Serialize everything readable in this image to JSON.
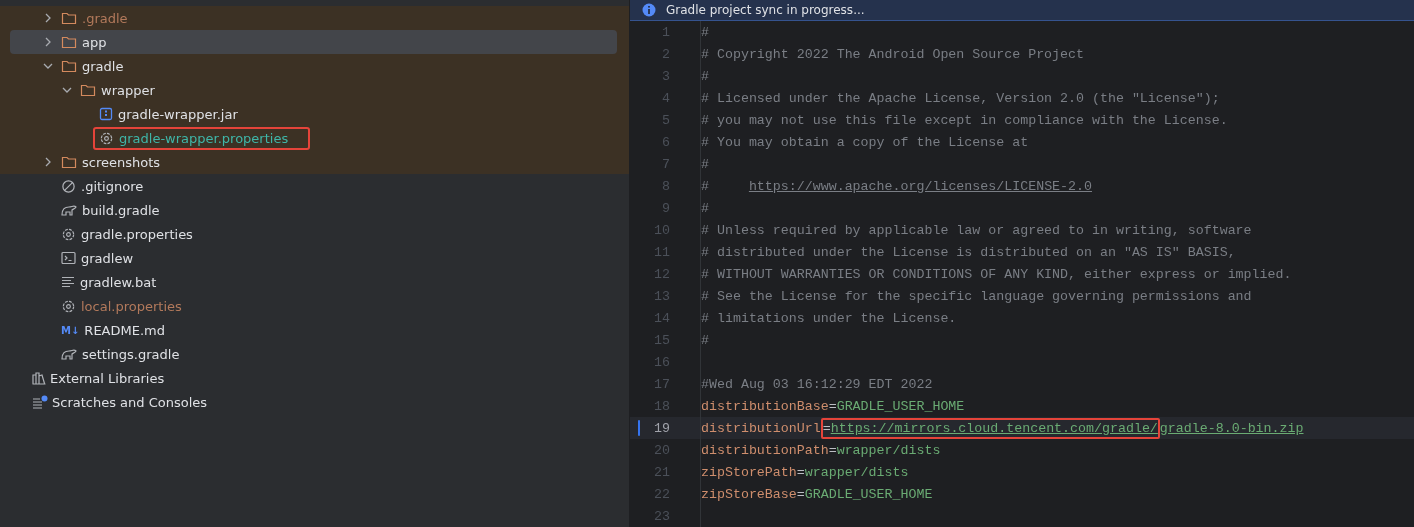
{
  "project_tree": {
    "items": [
      {
        "label": ".gradle",
        "kind": "folder",
        "expanded": false,
        "selected": false,
        "highlighted": true,
        "ignored": true,
        "modified": false,
        "outlined": false
      },
      {
        "label": "app",
        "kind": "folder",
        "expanded": false,
        "selected": true,
        "highlighted": true,
        "ignored": false,
        "modified": false,
        "outlined": false
      },
      {
        "label": "gradle",
        "kind": "folder",
        "expanded": true,
        "selected": false,
        "highlighted": true,
        "ignored": false,
        "modified": false,
        "outlined": false,
        "children": [
          {
            "label": "wrapper",
            "kind": "folder",
            "expanded": true,
            "selected": false,
            "highlighted": true,
            "ignored": false,
            "modified": false,
            "outlined": false,
            "children": [
              {
                "label": "gradle-wrapper.jar",
                "kind": "jar",
                "selected": false,
                "highlighted": true,
                "ignored": false,
                "modified": false,
                "outlined": false
              },
              {
                "label": "gradle-wrapper.properties",
                "kind": "properties",
                "selected": false,
                "highlighted": true,
                "ignored": false,
                "modified": true,
                "outlined": true
              }
            ]
          }
        ]
      },
      {
        "label": "screenshots",
        "kind": "folder",
        "expanded": false,
        "selected": false,
        "highlighted": true,
        "ignored": false,
        "modified": false,
        "outlined": false
      },
      {
        "label": ".gitignore",
        "kind": "ignore",
        "selected": false,
        "highlighted": false,
        "ignored": false,
        "modified": false,
        "outlined": false
      },
      {
        "label": "build.gradle",
        "kind": "gradle",
        "selected": false,
        "highlighted": false,
        "ignored": false,
        "modified": false,
        "outlined": false
      },
      {
        "label": "gradle.properties",
        "kind": "properties",
        "selected": false,
        "highlighted": false,
        "ignored": false,
        "modified": false,
        "outlined": false
      },
      {
        "label": "gradlew",
        "kind": "script",
        "selected": false,
        "highlighted": false,
        "ignored": false,
        "modified": false,
        "outlined": false
      },
      {
        "label": "gradlew.bat",
        "kind": "text",
        "selected": false,
        "highlighted": false,
        "ignored": false,
        "modified": false,
        "outlined": false
      },
      {
        "label": "local.properties",
        "kind": "properties",
        "selected": false,
        "highlighted": false,
        "ignored": true,
        "modified": false,
        "outlined": false
      },
      {
        "label": "README.md",
        "kind": "markdown",
        "icon_label": "M↓",
        "selected": false,
        "highlighted": false,
        "ignored": false,
        "modified": false,
        "outlined": false
      },
      {
        "label": "settings.gradle",
        "kind": "gradle",
        "selected": false,
        "highlighted": false,
        "ignored": false,
        "modified": false,
        "outlined": false
      }
    ],
    "root_items": [
      {
        "label": "External Libraries",
        "kind": "libraries",
        "selected": false
      },
      {
        "label": "Scratches and Consoles",
        "kind": "scratches",
        "selected": false
      }
    ]
  },
  "editor": {
    "banner": "Gradle project sync in progress...",
    "lines": [
      {
        "number": "1",
        "current": false,
        "tokens": [
          {
            "kind": "comment",
            "text": "#"
          }
        ]
      },
      {
        "number": "2",
        "current": false,
        "tokens": [
          {
            "kind": "comment",
            "text": "# Copyright 2022 The Android Open Source Project"
          }
        ]
      },
      {
        "number": "3",
        "current": false,
        "tokens": [
          {
            "kind": "comment",
            "text": "#"
          }
        ]
      },
      {
        "number": "4",
        "current": false,
        "tokens": [
          {
            "kind": "comment",
            "text": "# Licensed under the Apache License, Version 2.0 (the \"License\");"
          }
        ]
      },
      {
        "number": "5",
        "current": false,
        "tokens": [
          {
            "kind": "comment",
            "text": "# you may not use this file except in compliance with the License."
          }
        ]
      },
      {
        "number": "6",
        "current": false,
        "tokens": [
          {
            "kind": "comment",
            "text": "# You may obtain a copy of the License at"
          }
        ]
      },
      {
        "number": "7",
        "current": false,
        "tokens": [
          {
            "kind": "comment",
            "text": "#"
          }
        ]
      },
      {
        "number": "8",
        "current": false,
        "tokens": [
          {
            "kind": "comment",
            "text": "#     "
          },
          {
            "kind": "comment_link",
            "text": "https://www.apache.org/licenses/LICENSE-2.0"
          }
        ]
      },
      {
        "number": "9",
        "current": false,
        "tokens": [
          {
            "kind": "comment",
            "text": "#"
          }
        ]
      },
      {
        "number": "10",
        "current": false,
        "tokens": [
          {
            "kind": "comment",
            "text": "# Unless required by applicable law or agreed to in writing, software"
          }
        ]
      },
      {
        "number": "11",
        "current": false,
        "tokens": [
          {
            "kind": "comment",
            "text": "# distributed under the License is distributed on an \"AS IS\" BASIS,"
          }
        ]
      },
      {
        "number": "12",
        "current": false,
        "tokens": [
          {
            "kind": "comment",
            "text": "# WITHOUT WARRANTIES OR CONDITIONS OF ANY KIND, either express or implied."
          }
        ]
      },
      {
        "number": "13",
        "current": false,
        "tokens": [
          {
            "kind": "comment",
            "text": "# See the License for the specific language governing permissions and"
          }
        ]
      },
      {
        "number": "14",
        "current": false,
        "tokens": [
          {
            "kind": "comment",
            "text": "# limitations under the License."
          }
        ]
      },
      {
        "number": "15",
        "current": false,
        "tokens": [
          {
            "kind": "comment",
            "text": "#"
          }
        ]
      },
      {
        "number": "16",
        "current": false
      },
      {
        "number": "17",
        "current": false,
        "tokens": [
          {
            "kind": "comment",
            "text": "#Wed Aug 03 16:12:29 EDT 2022"
          }
        ]
      },
      {
        "number": "18",
        "current": false,
        "tokens": [
          {
            "kind": "key",
            "text": "distributionBase"
          },
          {
            "kind": "op",
            "text": "="
          },
          {
            "kind": "value",
            "text": "GRADLE_USER_HOME"
          }
        ]
      },
      {
        "number": "19",
        "current": true,
        "tokens": [
          {
            "kind": "key",
            "text": "distributionUrl"
          },
          {
            "kind": "annotation",
            "tokens": [
              {
                "kind": "op",
                "text": "="
              },
              {
                "kind": "link",
                "text": "https://mirrors.cloud.tencent.com/gradle/"
              }
            ]
          },
          {
            "kind": "link",
            "text": "gradle-8.0-bin.zip"
          }
        ]
      },
      {
        "number": "20",
        "current": false,
        "tokens": [
          {
            "kind": "key",
            "text": "distributionPath"
          },
          {
            "kind": "op",
            "text": "="
          },
          {
            "kind": "value",
            "text": "wrapper/dists"
          }
        ]
      },
      {
        "number": "21",
        "current": false,
        "tokens": [
          {
            "kind": "key",
            "text": "zipStorePath"
          },
          {
            "kind": "op",
            "text": "="
          },
          {
            "kind": "value",
            "text": "wrapper/dists"
          }
        ]
      },
      {
        "number": "22",
        "current": false,
        "tokens": [
          {
            "kind": "key",
            "text": "zipStoreBase"
          },
          {
            "kind": "op",
            "text": "="
          },
          {
            "kind": "value",
            "text": "GRADLE_USER_HOME"
          }
        ]
      },
      {
        "number": "23",
        "current": false
      }
    ]
  }
}
